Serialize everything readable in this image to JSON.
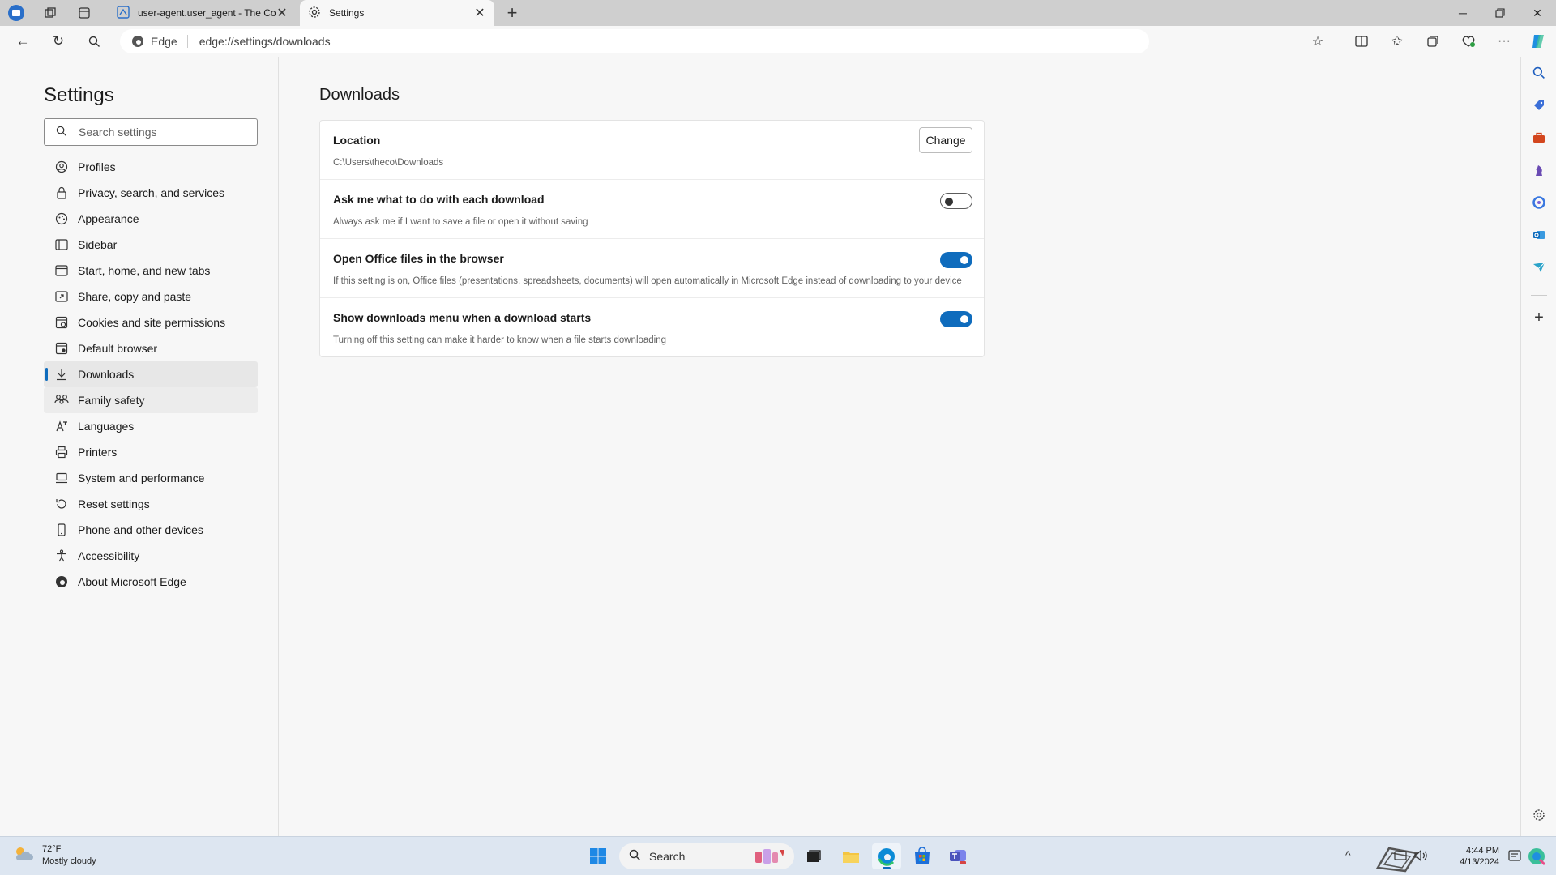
{
  "browser": {
    "tabs": [
      {
        "title": "user-agent.user_agent - The Coll",
        "active": false
      },
      {
        "title": "Settings",
        "active": true
      }
    ],
    "address": {
      "site_label": "Edge",
      "url": "edge://settings/downloads"
    }
  },
  "settings": {
    "title": "Settings",
    "search_placeholder": "Search settings",
    "nav": [
      {
        "label": "Profiles",
        "icon": "profile-icon"
      },
      {
        "label": "Privacy, search, and services",
        "icon": "lock-icon"
      },
      {
        "label": "Appearance",
        "icon": "appearance-icon"
      },
      {
        "label": "Sidebar",
        "icon": "sidebar-icon"
      },
      {
        "label": "Start, home, and new tabs",
        "icon": "home-icon"
      },
      {
        "label": "Share, copy and paste",
        "icon": "share-icon"
      },
      {
        "label": "Cookies and site permissions",
        "icon": "cookies-icon"
      },
      {
        "label": "Default browser",
        "icon": "browser-icon"
      },
      {
        "label": "Downloads",
        "icon": "download-icon"
      },
      {
        "label": "Family safety",
        "icon": "family-icon"
      },
      {
        "label": "Languages",
        "icon": "languages-icon"
      },
      {
        "label": "Printers",
        "icon": "printer-icon"
      },
      {
        "label": "System and performance",
        "icon": "system-icon"
      },
      {
        "label": "Reset settings",
        "icon": "reset-icon"
      },
      {
        "label": "Phone and other devices",
        "icon": "phone-icon"
      },
      {
        "label": "Accessibility",
        "icon": "accessibility-icon"
      },
      {
        "label": "About Microsoft Edge",
        "icon": "edge-icon"
      }
    ],
    "selected": "Downloads"
  },
  "downloads": {
    "title": "Downloads",
    "location": {
      "title": "Location",
      "path": "C:\\Users\\theco\\Downloads",
      "button": "Change"
    },
    "ask": {
      "title": "Ask me what to do with each download",
      "desc": "Always ask me if I want to save a file or open it without saving",
      "enabled": false
    },
    "office": {
      "title": "Open Office files in the browser",
      "desc": "If this setting is on, Office files (presentations, spreadsheets, documents) will open automatically in Microsoft Edge instead of downloading to your device",
      "enabled": true
    },
    "menu": {
      "title": "Show downloads menu when a download starts",
      "desc": "Turning off this setting can make it harder to know when a file starts downloading",
      "enabled": true
    }
  },
  "taskbar": {
    "weather_temp": "72°F",
    "weather_desc": "Mostly cloudy",
    "search_label": "Search",
    "time": "4:44 PM",
    "date": "4/13/2024"
  },
  "colors": {
    "accent": "#0f6cbd",
    "tabstrip": "#cfcfcf",
    "taskbar": "#dde6f1"
  }
}
